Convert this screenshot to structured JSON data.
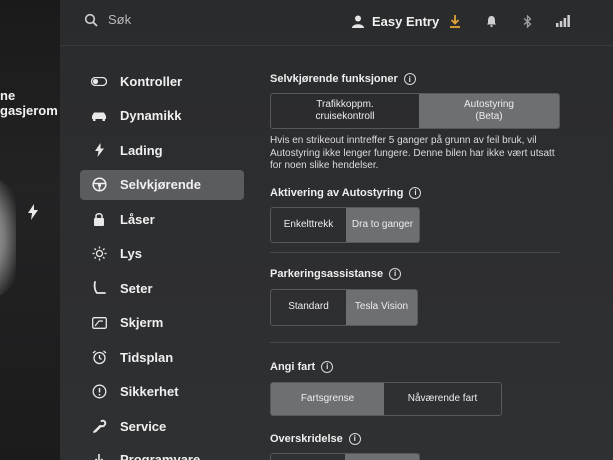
{
  "left_strip": {
    "line1": "ne",
    "line2": "gasjerom"
  },
  "topbar": {
    "search_placeholder": "Søk",
    "profile_name": "Easy Entry",
    "icons": [
      "download-icon",
      "bell-icon",
      "bluetooth-icon",
      "signal-icon"
    ],
    "download_color": "#e0a43a"
  },
  "sidebar": {
    "items": [
      {
        "label": "Kontroller",
        "icon": "toggle-icon"
      },
      {
        "label": "Dynamikk",
        "icon": "car-icon"
      },
      {
        "label": "Lading",
        "icon": "bolt-icon"
      },
      {
        "label": "Selvkjørende",
        "icon": "steering-wheel-icon",
        "active": true
      },
      {
        "label": "Låser",
        "icon": "lock-icon"
      },
      {
        "label": "Lys",
        "icon": "sun-icon"
      },
      {
        "label": "Seter",
        "icon": "seat-icon"
      },
      {
        "label": "Skjerm",
        "icon": "display-icon"
      },
      {
        "label": "Tidsplan",
        "icon": "alarm-clock-icon"
      },
      {
        "label": "Sikkerhet",
        "icon": "info-circle-icon"
      },
      {
        "label": "Service",
        "icon": "wrench-icon"
      },
      {
        "label": "Programvare",
        "icon": "download-icon"
      }
    ]
  },
  "content": {
    "self_driving": {
      "title": "Selvkjørende funksjoner",
      "options": [
        "Trafikkoppm. cruisekontroll",
        "Autostyring (Beta)"
      ],
      "selected": 1,
      "description": "Hvis en strikeout inntreffer 5 ganger på grunn av feil bruk, vil Autostyring ikke lenger fungere. Denne bilen har ikke vært utsatt for noen slike hendelser."
    },
    "autosteer_activation": {
      "title": "Aktivering av Autostyring",
      "options": [
        "Enkelttrekk",
        "Dra to ganger"
      ],
      "selected": 1
    },
    "park_assist": {
      "title": "Parkeringsassistanse",
      "options": [
        "Standard",
        "Tesla Vision"
      ],
      "selected": 1
    },
    "set_speed": {
      "title": "Angi fart",
      "options": [
        "Fartsgrense",
        "Nåværende fart"
      ],
      "selected": 0
    },
    "speed_offset": {
      "title": "Overskridelse"
    }
  },
  "colors": {
    "screen_bg": "#2c2d2f",
    "active_item": "#5b5c5f",
    "selected_segment": "#6e6f72",
    "accent_download": "#e0a43a"
  }
}
